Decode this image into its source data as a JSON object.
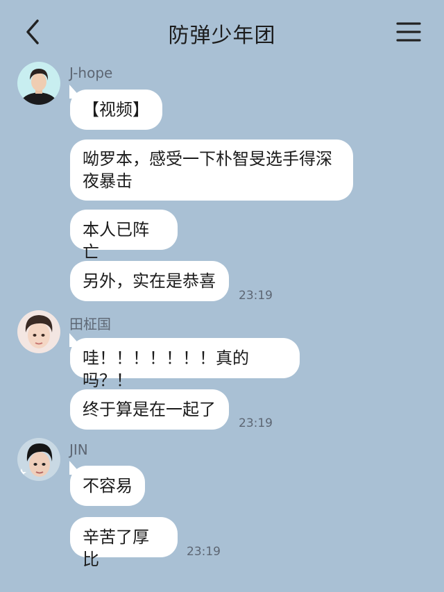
{
  "header": {
    "title": "防弹少年团"
  },
  "messages": [
    {
      "sender": "J-hope",
      "bubbles": [
        "【视频】",
        "呦罗本，感受一下朴智旻选手得深夜暴击",
        "本人已阵亡",
        "另外，实在是恭喜"
      ],
      "time": "23:19"
    },
    {
      "sender": "田柾国",
      "bubbles": [
        "哇！！！！！！！真的吗？！",
        "终于算是在一起了"
      ],
      "time": "23:19"
    },
    {
      "sender": "JIN",
      "bubbles": [
        "不容易",
        "辛苦了厚比"
      ],
      "time": "23:19"
    }
  ],
  "colors": {
    "background": "#a9c0d4",
    "bubble": "#ffffff"
  },
  "icons": [
    "back-arrow-icon",
    "menu-icon"
  ]
}
